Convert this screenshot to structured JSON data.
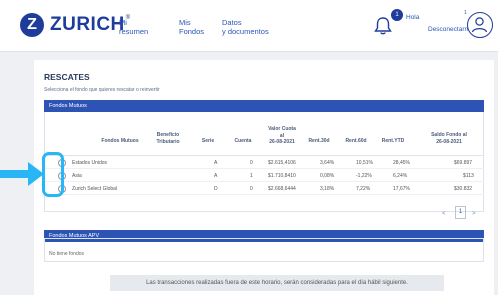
{
  "header": {
    "brand": "ZURICH",
    "brand_mark": "Z",
    "brand_reg": "®",
    "nav": [
      {
        "line1": "Mi",
        "line2": "resumen"
      },
      {
        "line1": "Mis",
        "line2": "Fondos"
      },
      {
        "line1": "Datos",
        "line2": "y documentos"
      }
    ],
    "notification_count": "1",
    "greeting": "Hola",
    "logout_count": "1",
    "logout_label": "Desconectarme"
  },
  "page": {
    "title": "RESCATES",
    "subtitle": "Selecciona el fondo que quieres rescatar o reinvertir"
  },
  "funds_table": {
    "section_label": "Fondos Mutuos",
    "headers": {
      "fondos": "Fondos Mutuos",
      "beneficio": [
        "Beneficio",
        "Tributario"
      ],
      "serie": "Serie",
      "cuenta": "Cuenta",
      "valor_cuota": [
        "Valor Cuota",
        "al",
        "26-08-2021"
      ],
      "rent30": "Rent.30d",
      "rent60": "Rent.60d",
      "rentytd": "Rent.YTD",
      "saldo": [
        "Saldo Fondo al",
        "26-08-2021"
      ]
    },
    "rows": [
      {
        "fondo": "Estados Unidos",
        "serie": "A",
        "cuenta": "0",
        "valor_cuota": "$2.615,4106",
        "rent30": "3,64%",
        "rent60": "10,51%",
        "rentytd": "28,45%",
        "saldo": "$69.897"
      },
      {
        "fondo": "Asia",
        "serie": "A",
        "cuenta": "1",
        "valor_cuota": "$1.710,8410",
        "rent30": "0,08%",
        "rent60": "-1,22%",
        "rentytd": "6,24%",
        "saldo": "$113"
      },
      {
        "fondo": "Zurich Select Global",
        "serie": "D",
        "cuenta": "0",
        "valor_cuota": "$2.668,6444",
        "rent30": "3,18%",
        "rent60": "7,22%",
        "rentytd": "17,67%",
        "saldo": "$30.832"
      }
    ],
    "pager": {
      "prev": "<",
      "current": "1",
      "next": ">"
    }
  },
  "apv_table": {
    "section_label": "Fondos Mutuos APV",
    "empty_text": "No tiene fondos"
  },
  "footer_notice": "Las transacciones realizadas fuera de este horario, serán consideradas para el día hábil siguiente.",
  "colors": {
    "brand": "#1e3c9a",
    "section_bar": "#2d54b5",
    "highlight": "#29b6f6"
  }
}
